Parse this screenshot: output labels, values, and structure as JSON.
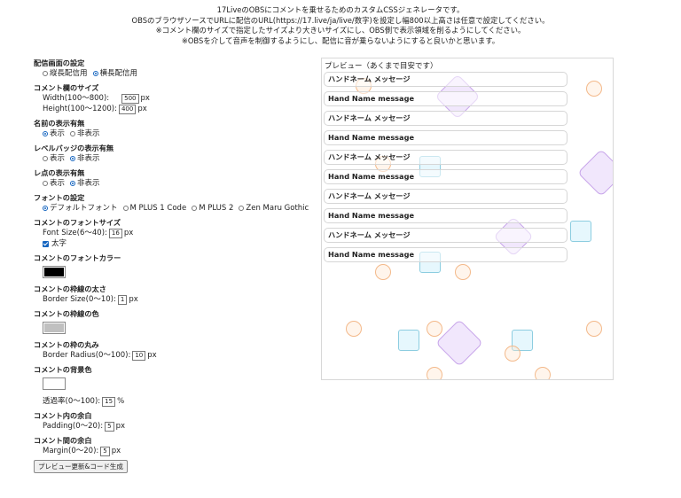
{
  "intro": [
    "17LiveのOBSにコメントを乗せるためのカスタムCSSジェネレータです。",
    "OBSのブラウザソースでURLに配信のURL(https://17.live/ja/live/数字)を設定し幅800以上高さは任意で設定してください。",
    "※コメント欄のサイズで指定したサイズより大きいサイズにし、OBS側で表示領域を削るようにしてください。",
    "※OBSを介して音声を制御するようにし、配信に音が乗らないようにすると良いかと思います。"
  ],
  "settings": {
    "orientation": {
      "title": "配信画面の設定",
      "options": [
        "縦長配信用",
        "横長配信用"
      ],
      "selected": 1
    },
    "size": {
      "title": "コメント欄のサイズ",
      "width_label": "Width(100～800):",
      "width_value": "500",
      "height_label": "Height(100～1200):",
      "height_value": "400",
      "unit": "px"
    },
    "name_display": {
      "title": "名前の表示有無",
      "options": [
        "表示",
        "非表示"
      ],
      "selected": 0
    },
    "level_badge": {
      "title": "レベルバッジの表示有無",
      "options": [
        "表示",
        "非表示"
      ],
      "selected": 1
    },
    "dot": {
      "title": "レ点の表示有無",
      "options": [
        "表示",
        "非表示"
      ],
      "selected": 1
    },
    "font": {
      "title": "フォントの設定",
      "options": [
        "デフォルトフォント",
        "M PLUS 1 Code",
        "M PLUS 2",
        "Zen Maru Gothic"
      ],
      "selected": 0
    },
    "font_size": {
      "title": "コメントのフォントサイズ",
      "label": "Font Size(6～40):",
      "value": "16",
      "unit": "px",
      "bold_label": "太字",
      "bold_checked": true
    },
    "font_color": {
      "title": "コメントのフォントカラー",
      "color": "#000000"
    },
    "border_size": {
      "title": "コメントの枠線の太さ",
      "label": "Border Size(0～10):",
      "value": "1",
      "unit": "px"
    },
    "border_color": {
      "title": "コメントの枠線の色",
      "color": "#c0c0c0"
    },
    "border_radius": {
      "title": "コメントの枠の丸み",
      "label": "Border Radius(0～100):",
      "value": "10",
      "unit": "px"
    },
    "bg_color": {
      "title": "コメントの背景色",
      "color": "#ffffff",
      "alpha_label": "透過率(0～100):",
      "alpha_value": "15",
      "alpha_unit": "%"
    },
    "padding": {
      "title": "コメント内の余白",
      "label": "Padding(0～20):",
      "value": "5",
      "unit": "px"
    },
    "margin": {
      "title": "コメント間の余白",
      "label": "Margin(0～20):",
      "value": "5",
      "unit": "px"
    },
    "submit_label": "プレビュー更新&コード生成"
  },
  "preview": {
    "title": "プレビュー（あくまで目安です）",
    "messages": [
      "ハンドネーム メッセージ",
      "Hand Name message",
      "ハンドネーム メッセージ",
      "Hand Name message",
      "ハンドネーム メッセージ",
      "Hand Name message",
      "ハンドネーム メッセージ",
      "Hand Name message",
      "ハンドネーム メッセージ",
      "Hand Name message"
    ]
  }
}
